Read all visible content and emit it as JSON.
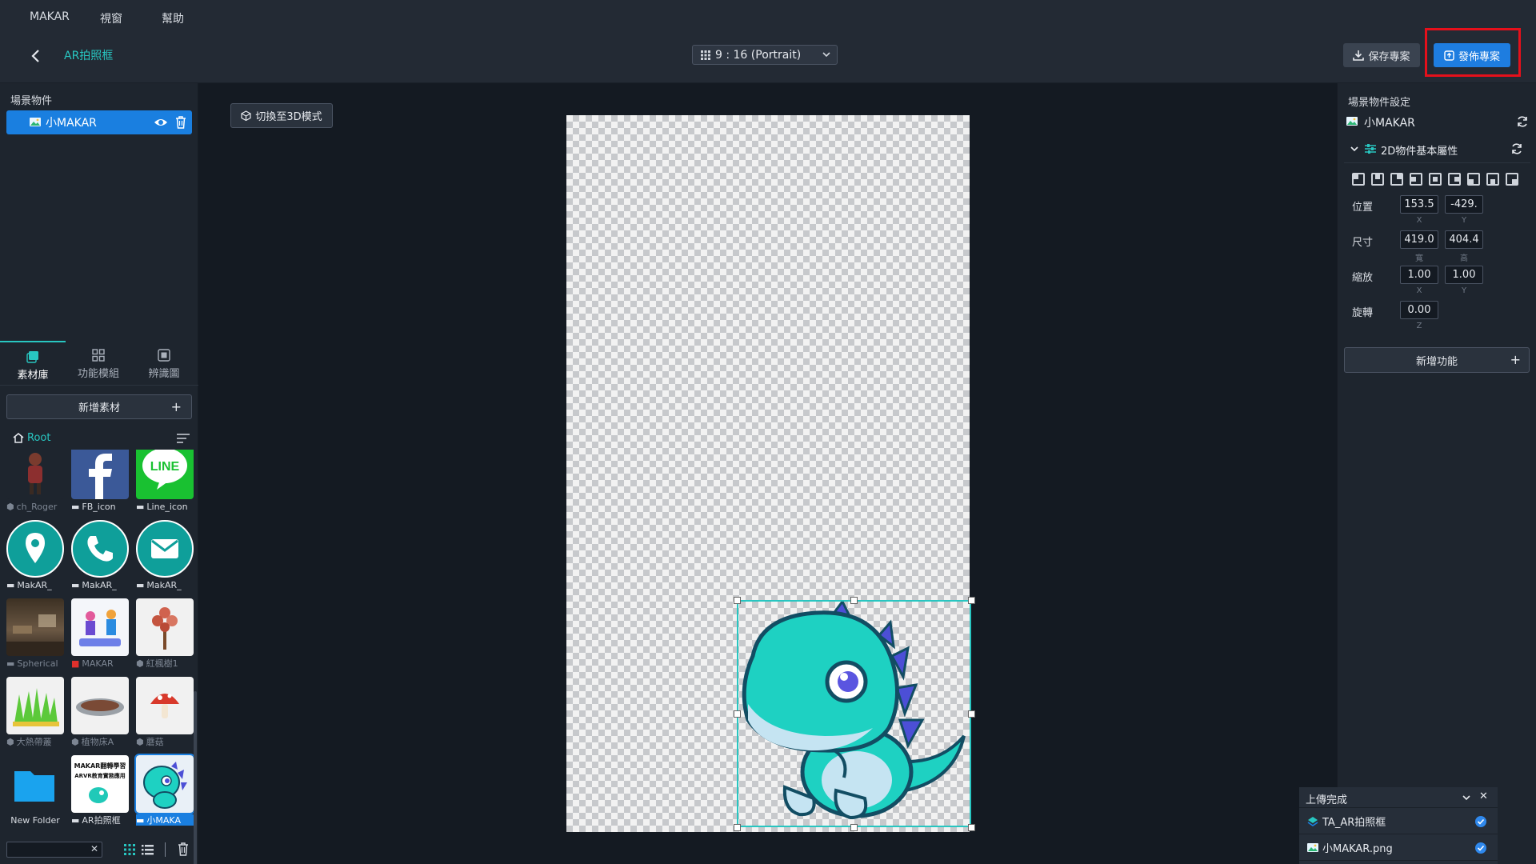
{
  "menu": [
    "MAKAR",
    "視窗",
    "幫助"
  ],
  "header": {
    "project_title": "AR拍照框",
    "ratio": "9 : 16 (Portrait)",
    "save_label": "保存專案",
    "publish_label": "發佈專案"
  },
  "left": {
    "scene_title": "場景物件",
    "scene_item": "小MAKAR",
    "tabs": [
      "素材庫",
      "功能模組",
      "辨識圖"
    ],
    "add_asset": "新增素材",
    "root": "Root",
    "assets": [
      {
        "label": "ch_Roger",
        "dim": true
      },
      {
        "label": "FB_icon",
        "dim": false
      },
      {
        "label": "Line_icon",
        "dim": false
      },
      {
        "label": "MakAR_",
        "dim": false
      },
      {
        "label": "MakAR_",
        "dim": false
      },
      {
        "label": "MakAR_",
        "dim": false
      },
      {
        "label": "Spherical",
        "dim": true
      },
      {
        "label": "MAKAR",
        "dim": true
      },
      {
        "label": "紅楓樹1",
        "dim": true
      },
      {
        "label": "大熱帶叢",
        "dim": true
      },
      {
        "label": "植物床A",
        "dim": true
      },
      {
        "label": "蘑菇",
        "dim": true
      },
      {
        "label": "New Folder",
        "dim": false
      },
      {
        "label": "AR拍照框",
        "dim": false
      },
      {
        "label": "小MAKA",
        "dim": false
      }
    ],
    "line_icon_text": "LINE",
    "ar_frame_text_1": "MAKAR翻轉學習",
    "ar_frame_text_2": "ARVR教育實務應用"
  },
  "canvas": {
    "mode_button": "切換至3D模式"
  },
  "right": {
    "title": "場景物件設定",
    "object_name": "小MAKAR",
    "section": "2D物件基本屬性",
    "rows": [
      {
        "label": "位置",
        "a": "153.5",
        "b": "-429.",
        "sa": "X",
        "sb": "Y"
      },
      {
        "label": "尺寸",
        "a": "419.0",
        "b": "404.4",
        "sa": "寬",
        "sb": "高"
      },
      {
        "label": "縮放",
        "a": "1.00",
        "b": "1.00",
        "sa": "X",
        "sb": "Y"
      },
      {
        "label": "旋轉",
        "a": "0.00",
        "sa": "Z"
      }
    ],
    "add_function": "新增功能"
  },
  "upload": {
    "title": "上傳完成",
    "items": [
      "TA_AR拍照框",
      "小MAKAR.png"
    ]
  },
  "colors": {
    "accent": "#28c6c1",
    "primary": "#1a7fe0",
    "highlight_border": "#e5101b"
  }
}
